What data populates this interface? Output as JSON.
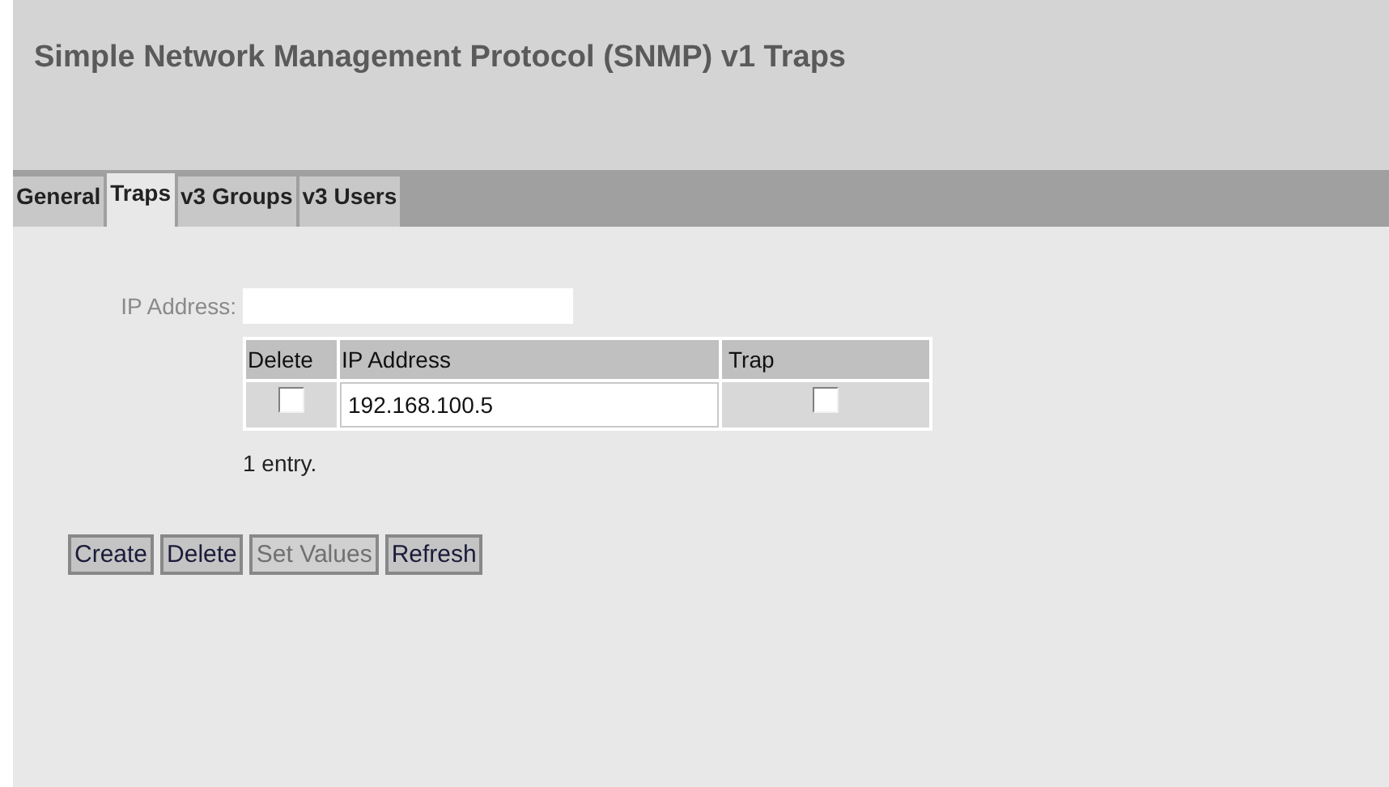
{
  "window": {
    "title": "Simple Network Management Protocol (SNMP) v1 Traps"
  },
  "tabs": [
    {
      "label": "General",
      "selected": false
    },
    {
      "label": "Traps",
      "selected": true
    },
    {
      "label": "v3 Groups",
      "selected": false
    },
    {
      "label": "v3 Users",
      "selected": false
    }
  ],
  "new_entry": {
    "label": "IP Address:",
    "disabled": true
  },
  "table": {
    "columns": [
      "Delete",
      "IP Address",
      "Trap"
    ],
    "rows": [
      {
        "delete": false,
        "ip_address": "192.168.100.5",
        "trap": false
      }
    ]
  },
  "entry_count": "1 entry.",
  "buttons": [
    {
      "label": "Create",
      "disabled": false
    },
    {
      "label": "Delete",
      "disabled": false
    },
    {
      "label": "Set Values",
      "disabled": true
    },
    {
      "label": "Refresh",
      "disabled": false
    }
  ]
}
